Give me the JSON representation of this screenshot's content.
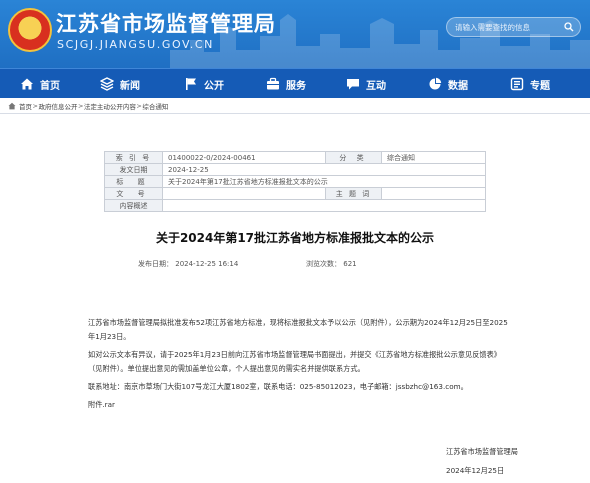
{
  "header": {
    "site_title": "江苏省市场监督管理局",
    "site_domain": "SCJGJ.JIANGSU.GOV.CN",
    "search_placeholder": "请输入需要查找的信息"
  },
  "nav": {
    "items": [
      {
        "label": "首页",
        "icon": "home-icon"
      },
      {
        "label": "新闻",
        "icon": "news-icon"
      },
      {
        "label": "公开",
        "icon": "flag-icon"
      },
      {
        "label": "服务",
        "icon": "service-icon"
      },
      {
        "label": "互动",
        "icon": "chat-icon"
      },
      {
        "label": "数据",
        "icon": "pie-chart-icon"
      },
      {
        "label": "专题",
        "icon": "topic-icon"
      }
    ]
  },
  "breadcrumb": {
    "items": [
      "首页",
      "政府信息公开",
      "法定主动公开内容",
      "综合通知"
    ],
    "separator": ">"
  },
  "meta": {
    "index_label": "索 引 号",
    "index_value": "01400022-0/2024-00461",
    "category_label": "分 类",
    "category_value": "综合通知",
    "date_label": "发文日期",
    "date_value": "2024-12-25",
    "title_label": "标 题",
    "title_value": "关于2024年第17批江苏省地方标准报批文本的公示",
    "docno_label": "文 号",
    "docno_value": "",
    "subject_label": "主 题 词",
    "subject_value": "",
    "summary_label": "内容概述",
    "summary_value": ""
  },
  "article": {
    "title": "关于2024年第17批江苏省地方标准报批文本的公示",
    "pub_label": "发布日期：",
    "pub_value": "2024-12-25 16:14",
    "views_label": "浏览次数：",
    "views_value": "621",
    "paragraphs": [
      "江苏省市场监督管理局拟批准发布52项江苏省地方标准，现将标准报批文本予以公示（见附件），公示期为2024年12月25日至2025年1月23日。",
      "如对公示文本有异议，请于2025年1月23日前向江苏省市场监督管理局书面提出，并提交《江苏省地方标准报批公示意见反馈表》（见附件）。单位提出意见的需加盖单位公章，个人提出意见的需实名并提供联系方式。",
      "联系地址：南京市草场门大街107号龙江大厦1802室，联系电话：025-85012023，电子邮箱：jssbzhc@163.com。"
    ],
    "attachment": "附件.rar",
    "signature": "江苏省市场监督管理局",
    "sign_date": "2024年12月25日"
  },
  "colors": {
    "header_blue": "#2a84d6",
    "nav_blue": "#155bb6",
    "emblem_red": "#d8301f",
    "emblem_gold": "#f7d154"
  }
}
